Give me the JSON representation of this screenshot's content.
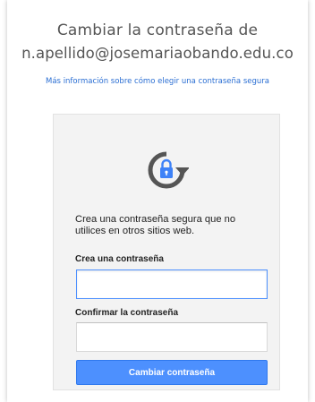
{
  "header": {
    "title_line1": "Cambiar la contraseña de",
    "title_line2": "n.apellido@josemariaobando.edu.co",
    "help_link": "Más información sobre cómo elegir una contraseña segura"
  },
  "card": {
    "icon": "lock-refresh-icon",
    "description": "Crea una contraseña segura que no utilices en otros sitios web.",
    "new_password": {
      "label": "Crea una contraseña",
      "value": "",
      "placeholder": ""
    },
    "confirm_password": {
      "label": "Confirmar la contraseña",
      "value": "",
      "placeholder": ""
    },
    "submit_label": "Cambiar contraseña"
  },
  "colors": {
    "accent": "#4d90fe",
    "link": "#2a6ed3",
    "lock_icon": "#3e82f7",
    "title_text": "#555555",
    "card_background": "#f3f3f3"
  }
}
